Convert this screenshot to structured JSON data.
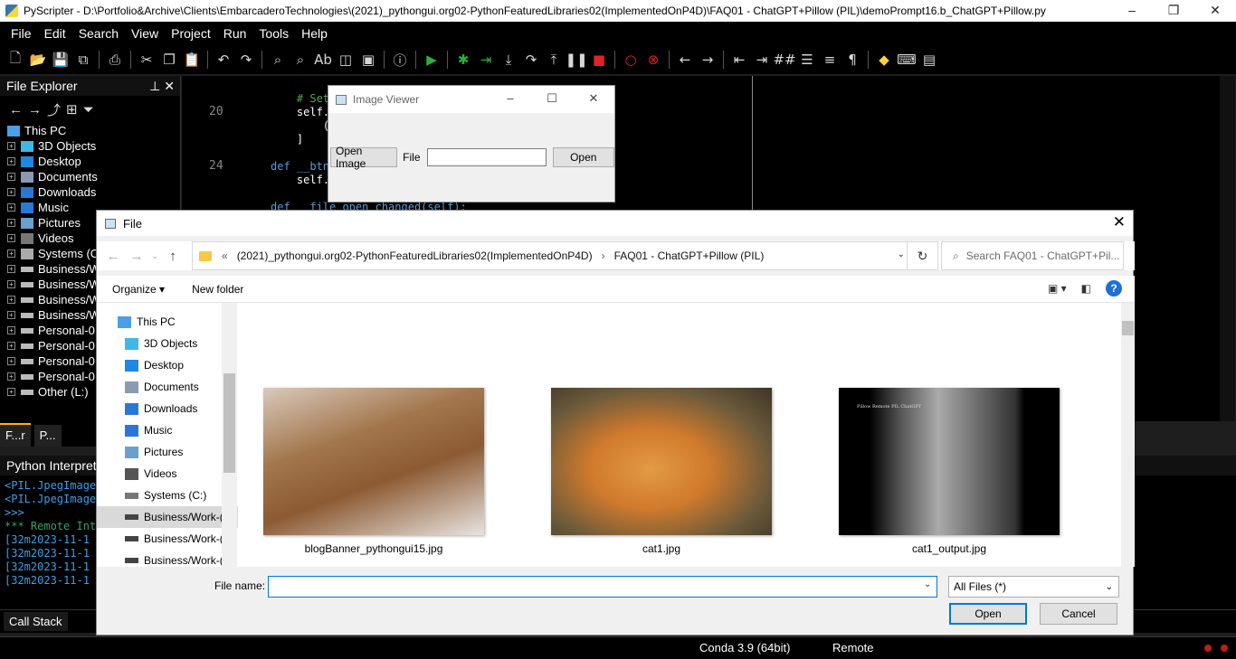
{
  "app": {
    "title": "PyScripter - D:\\Portfolio&Archive\\Clients\\EmbarcaderoTechnologies\\(2021)_pythongui.org02-PythonFeaturedLibraries02(ImplementedOnP4D)\\FAQ01 - ChatGPT+Pillow (PIL)\\demoPrompt16.b_ChatGPT+Pillow.py",
    "window_buttons": [
      "–",
      "❐",
      "✕"
    ]
  },
  "menu": [
    "File",
    "Edit",
    "Search",
    "View",
    "Project",
    "Run",
    "Tools",
    "Help"
  ],
  "file_explorer": {
    "title": "File Explorer",
    "root": "This PC",
    "items": [
      "3D Objects",
      "Desktop",
      "Documents",
      "Downloads",
      "Music",
      "Pictures",
      "Videos",
      "Systems (C",
      "Business/W",
      "Business/W",
      "Business/W",
      "Business/W",
      "Personal-0",
      "Personal-0",
      "Personal-0",
      "Personal-0",
      "Other (L:)"
    ],
    "tabs": [
      "F...r",
      "P..."
    ]
  },
  "editor": {
    "line_numbers": [
      "20",
      "24"
    ],
    "code_lines": [
      {
        "text": "    # Set",
        "color": "#57a64a"
      },
      {
        "text": "    self.",
        "color": "#ffffff"
      },
      {
        "text": "        (",
        "color": "#ffffff"
      },
      {
        "text": "    ]",
        "color": "#ffffff"
      },
      {
        "text": "",
        "color": "#ffffff"
      },
      {
        "text": "def __btn",
        "color": "#569cd6"
      },
      {
        "text": "    self.",
        "color": "#ffffff"
      },
      {
        "text": "",
        "color": "#ffffff"
      },
      {
        "text": "def __file_open_changed(self):",
        "color": "#569cd6"
      }
    ]
  },
  "interpreter": {
    "title": "Python Interprete",
    "lines": [
      "<PIL.JpegImage",
      "<PIL.JpegImage",
      ">>>",
      "*** Remote Int",
      "[32m2023-11-1",
      "[32m2023-11-1",
      "[32m2023-11-1",
      "[32m2023-11-1"
    ]
  },
  "bottom_tabs": [
    "Call Stack"
  ],
  "status": {
    "env": "Conda 3.9 (64bit)",
    "mode": "Remote"
  },
  "image_viewer": {
    "title": "Image Viewer",
    "open_image_label": "Open Image",
    "file_label": "File",
    "open_label": "Open",
    "buttons": [
      "–",
      "☐",
      "✕"
    ]
  },
  "file_dialog": {
    "title": "File",
    "close": "✕",
    "path_prefix": "«",
    "path": [
      "(2021)_pythongui.org02-PythonFeaturedLibraries02(ImplementedOnP4D)",
      "FAQ01 - ChatGPT+Pillow (PIL)"
    ],
    "search_placeholder": "Search FAQ01 - ChatGPT+Pil...",
    "organize": "Organize ▾",
    "new_folder": "New folder",
    "nav": [
      {
        "label": "This PC",
        "color": "#4aa0e6"
      },
      {
        "label": "3D Objects",
        "color": "#3fb8e8"
      },
      {
        "label": "Desktop",
        "color": "#1e88e5"
      },
      {
        "label": "Documents",
        "color": "#8a9bb0"
      },
      {
        "label": "Downloads",
        "color": "#2a78d6"
      },
      {
        "label": "Music",
        "color": "#2a78d6"
      },
      {
        "label": "Pictures",
        "color": "#6aa0cc"
      },
      {
        "label": "Videos",
        "color": "#555555"
      },
      {
        "label": "Systems (C:)",
        "color": "#777777"
      },
      {
        "label": "Business/Work-(",
        "color": "#444444"
      },
      {
        "label": "Business/Work-(",
        "color": "#444444"
      },
      {
        "label": "Business/Work-(",
        "color": "#444444"
      }
    ],
    "files": [
      "blogBanner_pythongui15.jpg",
      "cat1.jpg",
      "cat1_output.jpg"
    ],
    "thumb_caption": "Pillow Remote PIL ChatGPT",
    "file_name_label": "File name:",
    "file_name_value": "",
    "file_type": "All Files (*)",
    "open_button": "Open",
    "cancel_button": "Cancel"
  }
}
